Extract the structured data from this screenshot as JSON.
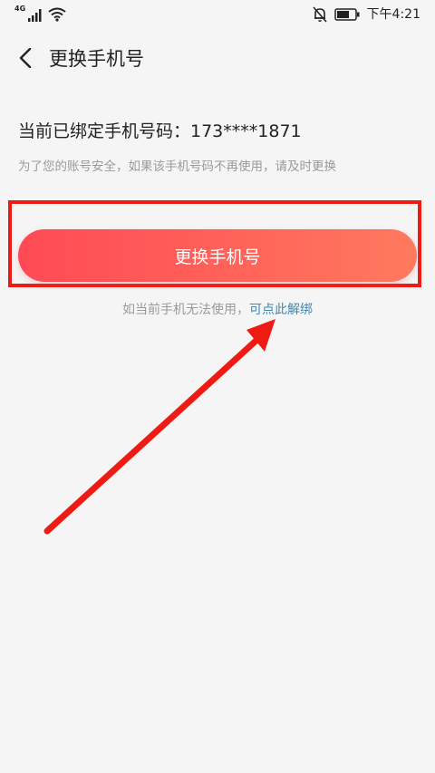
{
  "status_bar": {
    "network": "4G",
    "time": "下午4:21",
    "icons": [
      "signal-icon",
      "wifi-icon",
      "mute-bell-icon",
      "battery-icon"
    ]
  },
  "header": {
    "back_icon": "chevron-left-icon",
    "title": "更换手机号"
  },
  "content": {
    "bound_phone": "当前已绑定手机号码：173****1871",
    "notice": "为了您的账号安全，如果该手机号码不再使用，请及时更换",
    "button_label": "更换手机号",
    "help_text": "如当前手机无法使用，",
    "unbind_link": "可点此解绑"
  },
  "colors": {
    "background": "#f5f5f5",
    "button_start": "#ff4a55",
    "button_end": "#ff7a5e",
    "link": "#3f88b0",
    "annotation": "#ee1b14"
  }
}
